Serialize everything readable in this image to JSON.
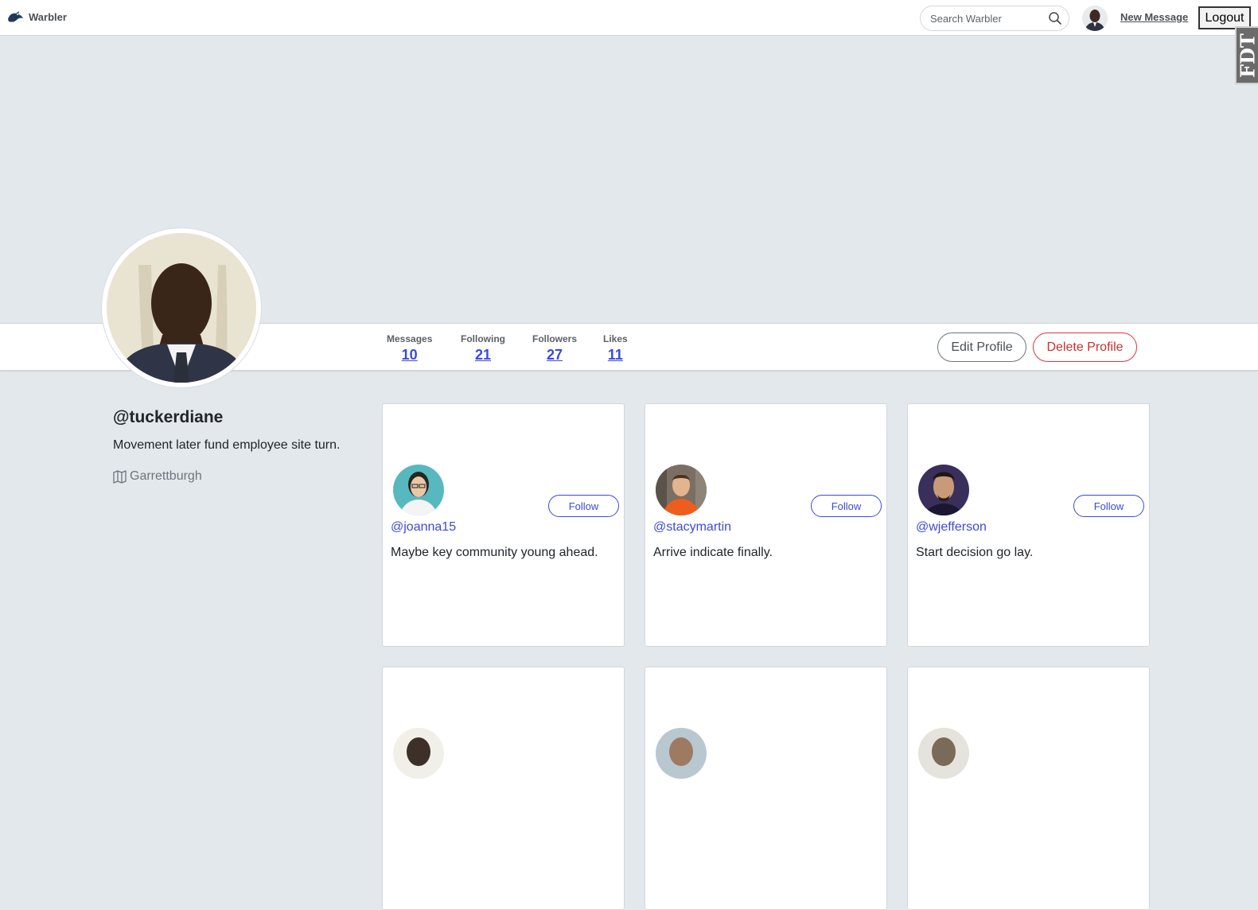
{
  "navbar": {
    "brand": "Warbler",
    "search_placeholder": "Search Warbler",
    "new_message": "New Message",
    "logout": "Logout",
    "debug_toolbar": "FDT"
  },
  "profile": {
    "username": "@tuckerdiane",
    "bio": "Movement later fund employee site turn.",
    "location": "Garrettburgh",
    "stats": [
      {
        "label": "Messages",
        "value": "10"
      },
      {
        "label": "Following",
        "value": "21"
      },
      {
        "label": "Followers",
        "value": "27"
      },
      {
        "label": "Likes",
        "value": "11"
      }
    ],
    "edit_label": "Edit Profile",
    "delete_label": "Delete Profile"
  },
  "cards": [
    {
      "handle": "@joanna15",
      "bio": "Maybe key community young ahead.",
      "follow_label": "Follow",
      "avatar_bg": "#58b8bf"
    },
    {
      "handle": "@stacymartin",
      "bio": "Arrive indicate finally.",
      "follow_label": "Follow",
      "avatar_bg": "#7b6f64"
    },
    {
      "handle": "@wjefferson",
      "bio": "Start decision go lay.",
      "follow_label": "Follow",
      "avatar_bg": "#3a2f5a"
    }
  ],
  "colors": {
    "accent": "#3b4ad8",
    "danger": "#dc3545",
    "page_bg": "#e3e8ec"
  }
}
